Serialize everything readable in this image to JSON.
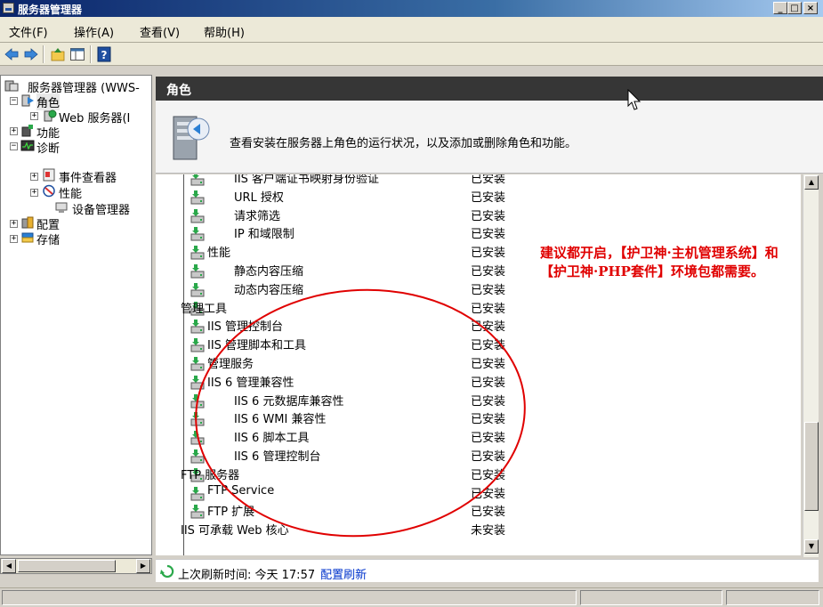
{
  "window": {
    "title": "服务器管理器",
    "controls": [
      "_",
      "□",
      "×"
    ]
  },
  "menu": {
    "items": [
      "文件(F)",
      "操作(A)",
      "查看(V)",
      "帮助(H)"
    ]
  },
  "toolbar": {
    "icons": [
      "back-icon",
      "forward-icon",
      "up-folder-icon",
      "show-hide-tree-icon",
      "help-icon"
    ]
  },
  "tree": {
    "items": [
      {
        "label": "服务器管理器 (WWS-"
      },
      {
        "label": "角色"
      },
      {
        "label": "Web 服务器(I"
      },
      {
        "label": "功能"
      },
      {
        "label": "诊断"
      },
      {
        "label": "事件查看器"
      },
      {
        "label": "性能"
      },
      {
        "label": "设备管理器"
      },
      {
        "label": "配置"
      },
      {
        "label": "存储"
      }
    ]
  },
  "pane": {
    "header": "角色",
    "banner_text": "查看安装在服务器上角色的运行状况，以及添加或删除角色和功能。",
    "note": "建议都开启，【护卫神·主机管理系统】和【护卫神·PHP套件】环境包都需要。",
    "rows": [
      {
        "name": "IIS 客户端证书映射身份验证",
        "status": "已安装"
      },
      {
        "name": "URL 授权",
        "status": "已安装"
      },
      {
        "name": "请求筛选",
        "status": "已安装"
      },
      {
        "name": "IP 和域限制",
        "status": "已安装"
      },
      {
        "name": "性能",
        "status": "已安装"
      },
      {
        "name": "静态内容压缩",
        "status": "已安装"
      },
      {
        "name": "动态内容压缩",
        "status": "已安装"
      },
      {
        "name": "管理工具",
        "status": "已安装"
      },
      {
        "name": "IIS 管理控制台",
        "status": "已安装"
      },
      {
        "name": "IIS 管理脚本和工具",
        "status": "已安装"
      },
      {
        "name": "管理服务",
        "status": "已安装"
      },
      {
        "name": "IIS 6 管理兼容性",
        "status": "已安装"
      },
      {
        "name": "IIS 6 元数据库兼容性",
        "status": "已安装"
      },
      {
        "name": "IIS 6 WMI 兼容性",
        "status": "已安装"
      },
      {
        "name": "IIS 6 脚本工具",
        "status": "已安装"
      },
      {
        "name": "IIS 6 管理控制台",
        "status": "已安装"
      },
      {
        "name": "FTP 服务器",
        "status": "已安装"
      },
      {
        "name": "FTP Service",
        "status": "已安装"
      },
      {
        "name": "FTP 扩展",
        "status": "已安装"
      },
      {
        "name": "IIS 可承载 Web 核心",
        "status": "未安装"
      }
    ],
    "refresh_label": "上次刷新时间: 今天 17:57",
    "refresh_link": "配置刷新"
  },
  "colors": {
    "annotation_red": "#e00000",
    "header_dark": "#363636",
    "link_blue": "#0033cc"
  }
}
